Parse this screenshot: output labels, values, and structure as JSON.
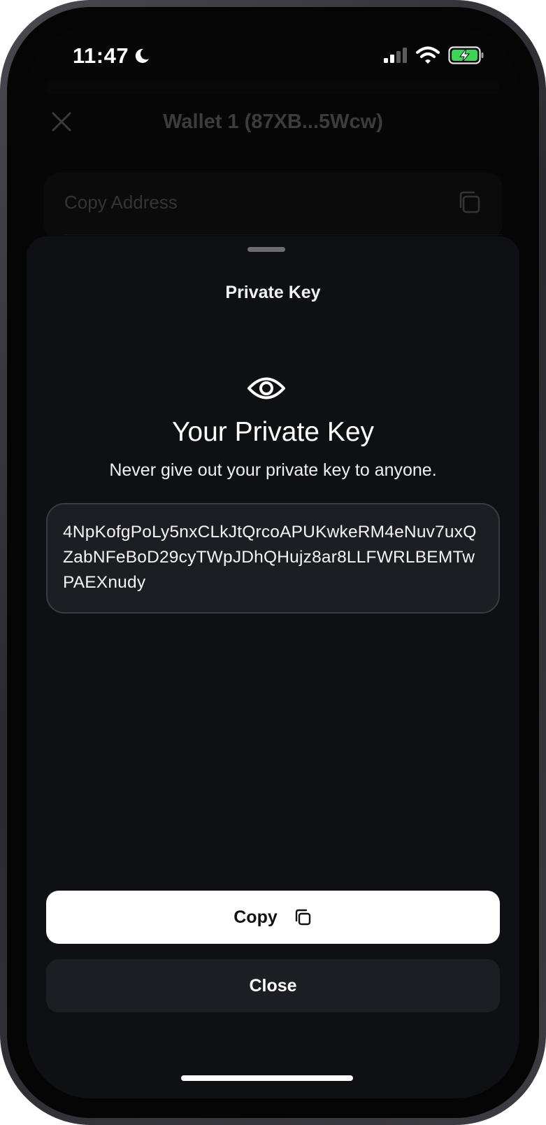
{
  "status_bar": {
    "time": "11:47",
    "icons": [
      "moon-icon",
      "cellular-signal-icon",
      "wifi-icon",
      "battery-charging-icon"
    ]
  },
  "header": {
    "title": "Wallet 1 (87XB...5Wcw)",
    "close_icon": "close-icon"
  },
  "background_list": {
    "copy_address_label": "Copy Address",
    "copy_icon": "copy-icon"
  },
  "sheet": {
    "title": "Private Key",
    "icon": "eye-icon",
    "heading": "Your Private Key",
    "warning": "Never give out your private key to anyone.",
    "private_key": "4NpKofgPoLy5nxCLkJtQrcoAPUKwkeRM4eNuv7uxQZabNFeBoD29cyTWpJDhQHujz8ar8LLFWRLBEMTwPAEXnudy",
    "copy_button_label": "Copy",
    "copy_button_icon": "copy-icon",
    "close_button_label": "Close"
  },
  "colors": {
    "sheet_background": "#0f1014",
    "key_box_background": "#1d1e23",
    "primary_button": "#ffffff",
    "battery_green": "#3fd35a"
  }
}
